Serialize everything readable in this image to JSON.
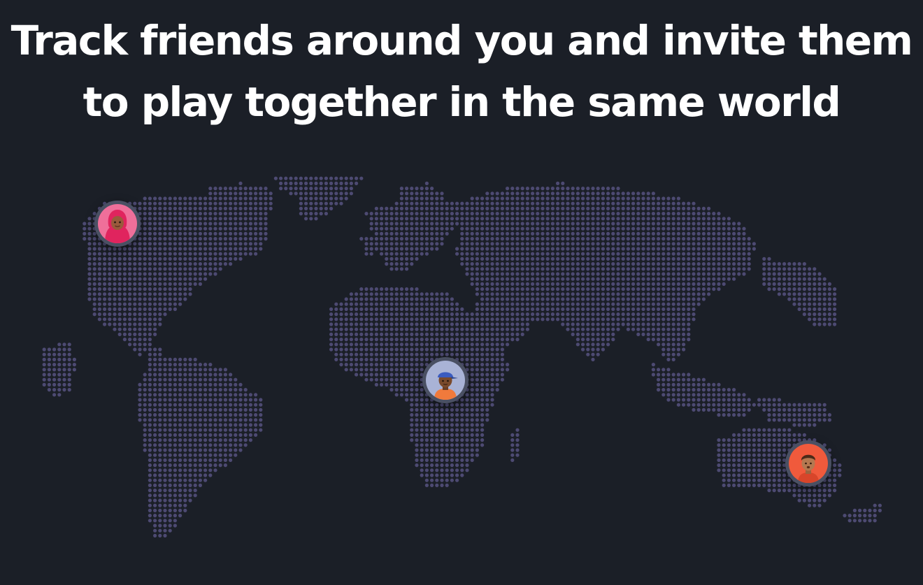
{
  "hero": {
    "title_line1": "Track friends around you and invite them",
    "title_line2": "to play together in the same world"
  },
  "map": {
    "dot_color": "#4d4a72",
    "background": "#1b1f27"
  },
  "friends": [
    {
      "name": "friend-north-america",
      "avatar": "girl-hijab-avatar",
      "bg": "#ef6f9a"
    },
    {
      "name": "friend-africa",
      "avatar": "boy-blue-cap-avatar",
      "bg": "#a9b3d6"
    },
    {
      "name": "friend-australia",
      "avatar": "boy-curly-hair-avatar",
      "bg": "#f05a3c"
    }
  ]
}
